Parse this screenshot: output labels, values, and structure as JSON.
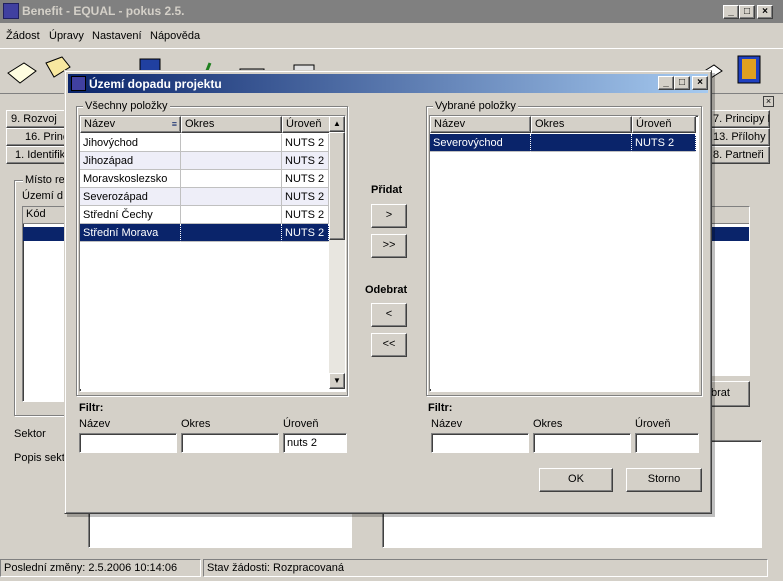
{
  "app": {
    "title": "Benefit - EQUAL - pokus 2.5.",
    "menu": [
      "Žádost",
      "Úpravy",
      "Nastavení",
      "Nápověda"
    ]
  },
  "background": {
    "tabs_left": [
      "9. Rozvoj",
      "16. Princ",
      "1. Identifik"
    ],
    "tabs_right": [
      "7. Principy I",
      "13. Přílohy",
      "8. Partneři"
    ],
    "group_label": "Místo re",
    "uzemi_label": "Území d",
    "kod_header": "Kód",
    "sektor_label": "Sektor",
    "popis_label": "Popis sekt",
    "right_button": "brat"
  },
  "dialog": {
    "title": "Území dopadu projektu",
    "left_group": "Všechny položky",
    "right_group": "Vybrané položky",
    "columns": [
      "Název",
      "Okres",
      "Úroveň"
    ],
    "all_items": [
      {
        "nazev": "Jihovýchod",
        "okres": "",
        "uroven": "NUTS 2"
      },
      {
        "nazev": "Jihozápad",
        "okres": "",
        "uroven": "NUTS 2"
      },
      {
        "nazev": "Moravskoslezsko",
        "okres": "",
        "uroven": "NUTS 2"
      },
      {
        "nazev": "Severozápad",
        "okres": "",
        "uroven": "NUTS 2"
      },
      {
        "nazev": "Střední Čechy",
        "okres": "",
        "uroven": "NUTS 2"
      },
      {
        "nazev": "Střední Morava",
        "okres": "",
        "uroven": "NUTS 2"
      }
    ],
    "selected_items": [
      {
        "nazev": "Severovýchod",
        "okres": "",
        "uroven": "NUTS 2"
      }
    ],
    "pridat_label": "Přidat",
    "odebrat_label": "Odebrat",
    "add_one": ">",
    "add_all": ">>",
    "remove_one": "<",
    "remove_all": "<<",
    "filter_label": "Filtr:",
    "filter_left": {
      "nazev": "",
      "okres": "",
      "uroven": "nuts 2"
    },
    "filter_right": {
      "nazev": "",
      "okres": "",
      "uroven": ""
    },
    "ok_label": "OK",
    "storno_label": "Storno"
  },
  "status": {
    "last_change": "Poslední změny: 2.5.2006 10:14:06",
    "state": "Stav žádosti: Rozpracovaná"
  },
  "colors": {
    "selection": "#0a246a",
    "dialog_title_start": "#0a246a",
    "dialog_title_end": "#a6caf0",
    "inactive_title": "#808080"
  }
}
